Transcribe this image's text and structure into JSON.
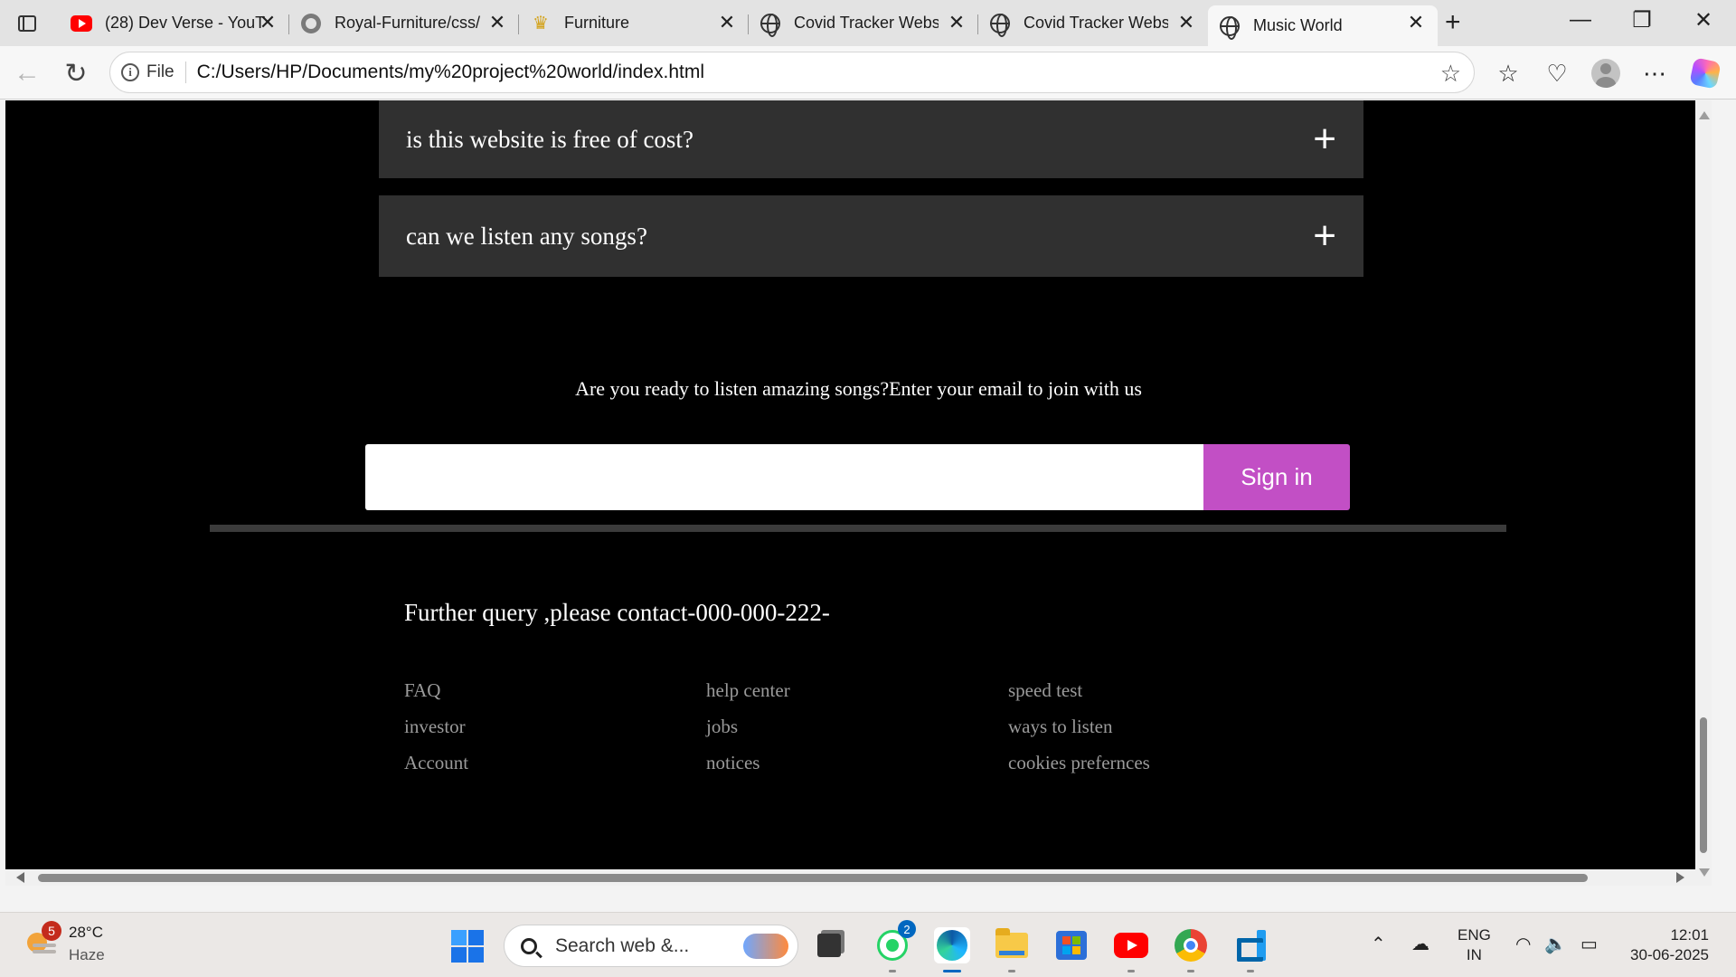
{
  "browser": {
    "tabs": [
      {
        "title": "(28) Dev Verse - YouT",
        "favicon": "youtube-icon",
        "active": false
      },
      {
        "title": "Royal-Furniture/css/",
        "favicon": "github-icon",
        "active": false
      },
      {
        "title": "Furniture",
        "favicon": "crown-icon",
        "active": false
      },
      {
        "title": "Covid Tracker Website",
        "favicon": "globe-icon",
        "active": false
      },
      {
        "title": "Covid Tracker Website",
        "favicon": "globe-icon",
        "active": false
      },
      {
        "title": "Music World",
        "favicon": "globe-icon",
        "active": true
      }
    ],
    "close_glyph": "✕",
    "new_tab_glyph": "+",
    "address": {
      "scheme_label": "File",
      "url": "C:/Users/HP/Documents/my%20project%20world/index.html"
    }
  },
  "page": {
    "faq": [
      {
        "question": "is this website is free of cost?",
        "toggle": "+"
      },
      {
        "question": "can we listen any songs?",
        "toggle": "+"
      }
    ],
    "cta_text": "Are you ready to listen amazing songs?Enter your email to join with us",
    "email_input": {
      "value": "",
      "placeholder": ""
    },
    "signin_label": "Sign in",
    "contact_text": "Further query ,please contact-000-000-222-",
    "footer_links": [
      [
        "FAQ",
        "investor",
        "Account"
      ],
      [
        "help center",
        "jobs",
        "notices"
      ],
      [
        "speed test",
        "ways to listen",
        "cookies prefernces"
      ]
    ],
    "colors": {
      "background": "#000000",
      "faq_panel": "#303030",
      "button": "#c24fc5",
      "link": "#9a9a9a"
    }
  },
  "taskbar": {
    "weather": {
      "badge": "5",
      "temp": "28°C",
      "condition": "Haze"
    },
    "search_text": "Search web &...",
    "whatsapp_badge": "2",
    "apps": [
      "task-view-icon",
      "whatsapp-icon",
      "edge-icon",
      "file-explorer-icon",
      "store-icon",
      "youtube-icon",
      "chrome-icon",
      "vscode-icon"
    ],
    "language": {
      "line1": "ENG",
      "line2": "IN"
    },
    "clock": {
      "time": "12:01",
      "date": "30-06-2025"
    }
  }
}
